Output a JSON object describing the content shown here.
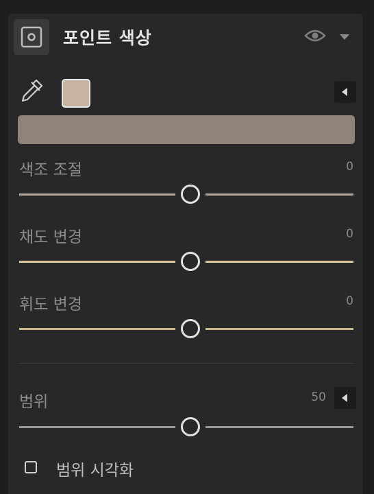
{
  "header": {
    "title": "포인트 색상",
    "icon": "point-color-icon",
    "visibility_icon": "eye-icon",
    "menu_icon": "chevron-down-icon"
  },
  "picker": {
    "eyedropper_icon": "eyedropper-icon",
    "swatch_color": "#c8b5a2",
    "bar_color": "#8f8477",
    "collapse_icon": "triangle-left-icon"
  },
  "sliders": [
    {
      "label": "색조 조절",
      "value": "0",
      "position": 0.5,
      "track_color": "#b8a89f"
    },
    {
      "label": "채도 변경",
      "value": "0",
      "position": 0.5,
      "track_color": "#d8c79f"
    },
    {
      "label": "휘도 변경",
      "value": "0",
      "position": 0.5,
      "track_color": "#c9b98a"
    }
  ],
  "range": {
    "label": "범위",
    "value": "50",
    "position": 0.5,
    "track_color": "#9a9a9a",
    "collapse_icon": "triangle-left-icon"
  },
  "visualize": {
    "label": "범위 시각화",
    "checked": false
  }
}
